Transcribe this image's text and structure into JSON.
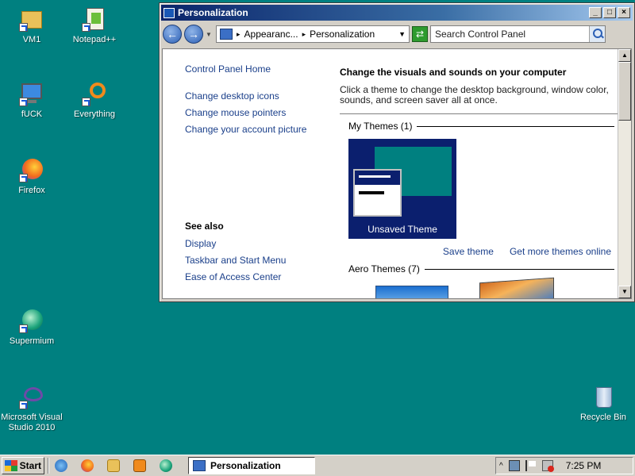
{
  "desktop": {
    "icons": [
      {
        "label": "VM1"
      },
      {
        "label": "Notepad++"
      },
      {
        "label": "fUCK"
      },
      {
        "label": "Everything"
      },
      {
        "label": "Firefox"
      },
      {
        "label": "Supermium"
      },
      {
        "label": "Microsoft Visual Studio 2010"
      },
      {
        "label": "Recycle Bin"
      }
    ]
  },
  "window": {
    "title": "Personalization",
    "controls": {
      "minimize": "_",
      "maximize": "□",
      "close": "×"
    },
    "address": {
      "crumb1": "Appearanc...",
      "crumb2": "Personalization"
    },
    "search_placeholder": "Search Control Panel",
    "left_pane": {
      "home": "Control Panel Home",
      "links": [
        "Change desktop icons",
        "Change mouse pointers",
        "Change your account picture"
      ],
      "see_also_heading": "See also",
      "see_also": [
        "Display",
        "Taskbar and Start Menu",
        "Ease of Access Center"
      ]
    },
    "right_pane": {
      "heading": "Change the visuals and sounds on your computer",
      "description": "Click a theme to change the desktop background, window color, sounds, and screen saver all at once.",
      "my_themes_label": "My Themes (1)",
      "unsaved_theme": "Unsaved Theme",
      "save_theme": "Save theme",
      "get_more_themes": "Get more themes online",
      "aero_themes_label": "Aero Themes (7)"
    }
  },
  "taskbar": {
    "start_label": "Start",
    "active_task": "Personalization",
    "clock": "7:25 PM"
  },
  "colors": {
    "desktop": "#008080",
    "title_bar": "#0a246a",
    "theme_tile": "#0b1f6e",
    "link": "#1a3f8a"
  }
}
